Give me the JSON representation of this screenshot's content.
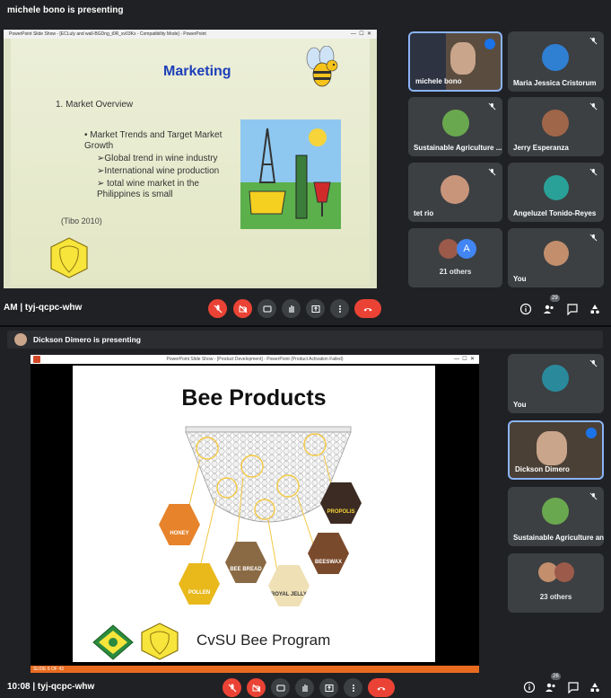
{
  "top": {
    "presenting": "michele bono is presenting",
    "slide_window_title": "PowerPoint Slide Show - [ECLuly and wall-BGDng_t0R_sv03Kx - Compatibility Mode] - PowerPoint",
    "slide": {
      "title": "Marketing",
      "list_item": "1.  Market Overview",
      "bullet": "• Market Trends and Target Market Growth",
      "subs": [
        "➢Global trend in wine industry",
        "➢International wine production",
        "➢ total wine market in the Philippines is small"
      ],
      "citation": "(Tibo 2010)",
      "logo_text": "CvSU"
    },
    "tiles": [
      {
        "name": "michele bono",
        "color": "#6b5b4a"
      },
      {
        "name": "Maria Jessica Cristorum",
        "color": "#3c4043"
      },
      {
        "name": "Sustainable Agriculture ...",
        "color": "#3c4043"
      },
      {
        "name": "Jerry Esperanza",
        "color": "#3c4043"
      },
      {
        "name": "tet rio",
        "color": "#3c4043"
      },
      {
        "name": "Angeluzel Tonido-Reyes",
        "color": "#3c4043"
      },
      {
        "name": "21 others",
        "color": "#3c4043",
        "letter": "A"
      },
      {
        "name": "You",
        "color": "#3c4043"
      }
    ],
    "meeting_code": "AM  |  tyj-qcpc-whw",
    "people_count": "29"
  },
  "bottom": {
    "presenting": "Dickson Dimero is presenting",
    "slide_window_title": "PowerPoint Slide Show - [Product Development] - PowerPoint (Product Activation Failed)",
    "slide": {
      "title": "Bee Products",
      "products": [
        "HONEY",
        "POLLEN",
        "BEE BREAD",
        "ROYAL JELLY",
        "BEESWAX",
        "PROPOLIS"
      ],
      "footer": "CvSU Bee Program",
      "slide_counter": "SLIDE 6 OF 43"
    },
    "tiles": [
      {
        "name": "You"
      },
      {
        "name": "Dickson Dimero"
      },
      {
        "name": "Sustainable Agriculture an..."
      },
      {
        "name": "23 others"
      }
    ],
    "meeting_code": "10:08  |  tyj-qcpc-whw",
    "people_count": "26"
  }
}
